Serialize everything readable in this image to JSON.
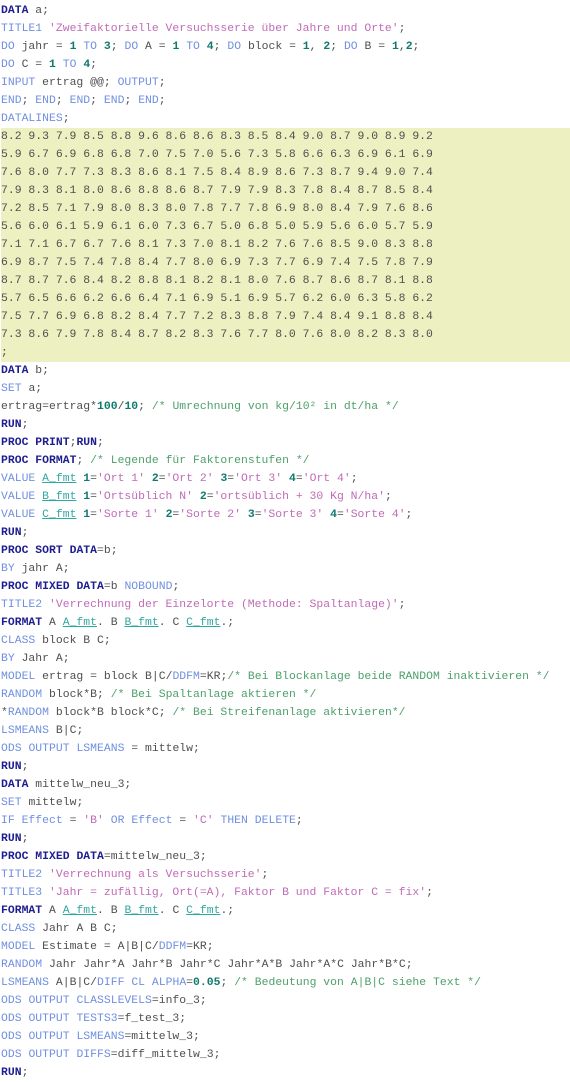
{
  "editor": {
    "language": "SAS",
    "colors": {
      "keyword": "#1d1d8f",
      "statement": "#6f8fe0",
      "string": "#c06bb6",
      "number": "#0f7a6e",
      "comment": "#4da06a",
      "plain": "#4f4f4f",
      "format_name": "#2fa8a0",
      "datalines_highlight": "#edf0c0",
      "background": "#ffffff"
    }
  },
  "code": {
    "lines": [
      "DATA a;",
      "TITLE1 'Zweifaktorielle Versuchsserie über Jahre und Orte';",
      "DO jahr = 1 TO 3; DO A = 1 TO 4; DO block = 1, 2; DO B = 1,2;",
      "DO C = 1 TO 4;",
      "INPUT ertrag @@; OUTPUT;",
      "END; END; END; END; END;",
      "DATALINES;",
      "8.2 9.3 7.9 8.5 8.8 9.6 8.6 8.6 8.3 8.5 8.4 9.0 8.7 9.0 8.9 9.2",
      "5.9 6.7 6.9 6.8 6.8 7.0 7.5 7.0 5.6 7.3 5.8 6.6 6.3 6.9 6.1 6.9",
      "7.6 8.0 7.7 7.3 8.3 8.6 8.1 7.5 8.4 8.9 8.6 7.3 8.7 9.4 9.0 7.4",
      "7.9 8.3 8.1 8.0 8.6 8.8 8.6 8.7 7.9 7.9 8.3 7.8 8.4 8.7 8.5 8.4",
      "7.2 8.5 7.1 7.9 8.0 8.3 8.0 7.8 7.7 7.8 6.9 8.0 8.4 7.9 7.6 8.6",
      "5.6 6.0 6.1 5.9 6.1 6.0 7.3 6.7 5.0 6.8 5.0 5.9 5.6 6.0 5.7 5.9",
      "7.1 7.1 6.7 6.7 7.6 8.1 7.3 7.0 8.1 8.2 7.6 7.6 8.5 9.0 8.3 8.8",
      "6.9 8.7 7.5 7.4 7.8 8.4 7.7 8.0 6.9 7.3 7.7 6.9 7.4 7.5 7.8 7.9",
      "8.7 8.7 7.6 8.4 8.2 8.8 8.1 8.2 8.1 8.0 7.6 8.7 8.6 8.7 8.1 8.8",
      "5.7 6.5 6.6 6.2 6.6 6.4 7.1 6.9 5.1 6.9 5.7 6.2 6.0 6.3 5.8 6.2",
      "7.5 7.7 6.9 6.8 8.2 8.4 7.7 7.2 8.3 8.8 7.9 7.4 8.4 9.1 8.8 8.4",
      "7.3 8.6 7.9 7.8 8.4 8.7 8.2 8.3 7.6 7.7 8.0 7.6 8.0 8.2 8.3 8.0",
      ";",
      "DATA b;",
      "SET a;",
      "ertrag=ertrag*100/10; /* Umrechnung von kg/10² in dt/ha */",
      "RUN;",
      "PROC PRINT;RUN;",
      "PROC FORMAT; /* Legende für Faktorenstufen */",
      "VALUE A_fmt 1='Ort 1' 2='Ort 2' 3='Ort 3' 4='Ort 4';",
      "VALUE B_fmt 1='Ortsüblich N' 2='ortsüblich + 30 Kg N/ha';",
      "VALUE C_fmt 1='Sorte 1' 2='Sorte 2' 3='Sorte 3' 4='Sorte 4';",
      "RUN;",
      "PROC SORT DATA=b;",
      "BY jahr A;",
      "PROC MIXED DATA=b NOBOUND;",
      "TITLE2 'Verrechnung der Einzelorte (Methode: Spaltanlage)';",
      "FORMAT A A_fmt. B B_fmt. C C_fmt.;",
      "CLASS block B C;",
      "BY Jahr A;",
      "MODEL ertrag = block B|C/DDFM=KR;/* Bei Blockanlage beide RANDOM inaktivieren */",
      "RANDOM block*B; /* Bei Spaltanlage aktieren */",
      "*RANDOM block*B block*C; /* Bei Streifenanlage aktivieren*/",
      "LSMEANS B|C;",
      "ODS OUTPUT LSMEANS = mittelw;",
      "RUN;",
      "DATA mittelw_neu_3;",
      "SET mittelw;",
      "IF Effect = 'B' OR Effect = 'C' THEN DELETE;",
      "RUN;",
      "PROC MIXED DATA=mittelw_neu_3;",
      "TITLE2 'Verrechnung als Versuchsserie';",
      "TITLE3 'Jahr = zufällig, Ort(=A), Faktor B und Faktor C = fix';",
      "FORMAT A A_fmt. B B_fmt. C C_fmt.;",
      "CLASS Jahr A B C;",
      "MODEL Estimate = A|B|C/DDFM=KR;",
      "RANDOM Jahr Jahr*A Jahr*B Jahr*C Jahr*A*B Jahr*A*C Jahr*B*C;",
      "LSMEANS A|B|C/DIFF CL ALPHA=0.05; /* Bedeutung von A|B|C siehe Text */",
      "ODS OUTPUT CLASSLEVELS=info_3;",
      "ODS OUTPUT TESTS3=f_test_3;",
      "ODS OUTPUT LSMEANS=mittelw_3;",
      "ODS OUTPUT DIFFS=diff_mittelw_3;",
      "RUN;"
    ],
    "datalines_start_index": 7,
    "datalines_end_index": 19
  }
}
